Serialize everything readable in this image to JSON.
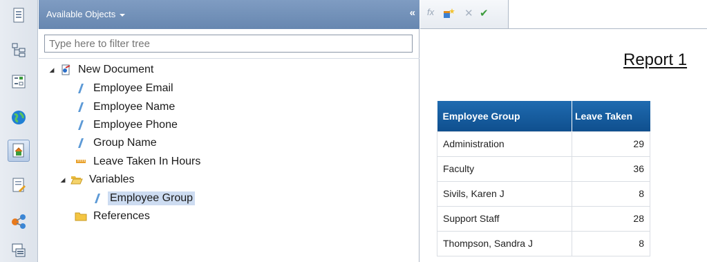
{
  "panel": {
    "title": "Available Objects",
    "collapse_label": "«",
    "filter_placeholder": "Type here to filter tree"
  },
  "tree": {
    "root": "New Document",
    "objects": [
      "Employee Email",
      "Employee Name",
      "Employee Phone",
      "Group Name"
    ],
    "measure": "Leave Taken In Hours",
    "variables_folder": "Variables",
    "variables": [
      "Employee Group"
    ],
    "references_folder": "References"
  },
  "formula_bar": {
    "fx_label": "fx",
    "cancel_label": "✕",
    "validate_label": "✔"
  },
  "report": {
    "title": "Report 1",
    "table": {
      "headers": [
        "Employee Group",
        "Leave Taken"
      ],
      "rows": [
        [
          "Administration",
          "29"
        ],
        [
          "Faculty",
          "36"
        ],
        [
          "Sivils, Karen J",
          "8"
        ],
        [
          "Support Staff",
          "28"
        ],
        [
          "Thompson, Sandra J",
          "8"
        ]
      ]
    }
  },
  "colors": {
    "panel_header": "#7391b9",
    "table_header": "#1a5fa3",
    "selection": "#cddcf1"
  },
  "icons": {
    "toolbar": [
      "document-icon",
      "tree-structure-icon",
      "input-controls-icon",
      "globe-icon",
      "document-home-icon",
      "edit-document-icon",
      "share-icon",
      "comments-icon"
    ],
    "dimension": "dimension-icon",
    "measure": "measure-icon",
    "folder": "folder-icon"
  }
}
